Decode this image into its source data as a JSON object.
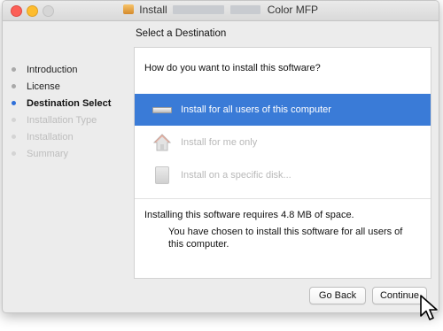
{
  "window": {
    "title_prefix": "Install",
    "title_suffix": "Color MFP"
  },
  "header": {
    "title": "Select a Destination"
  },
  "sidebar": {
    "steps": [
      {
        "label": "Introduction",
        "state": "done"
      },
      {
        "label": "License",
        "state": "done"
      },
      {
        "label": "Destination Select",
        "state": "current"
      },
      {
        "label": "Installation Type",
        "state": "future"
      },
      {
        "label": "Installation",
        "state": "future"
      },
      {
        "label": "Summary",
        "state": "future"
      }
    ]
  },
  "main": {
    "question": "How do you want to install this software?",
    "options": [
      {
        "label": "Install for all users of this computer",
        "icon": "drive-icon",
        "selected": true,
        "enabled": true
      },
      {
        "label": "Install for me only",
        "icon": "home-folder-icon",
        "selected": false,
        "enabled": false
      },
      {
        "label": "Install on a specific disk...",
        "icon": "disk-icon",
        "selected": false,
        "enabled": false
      }
    ],
    "requirement": "Installing this software requires 4.8 MB of space.",
    "chosen": "You have chosen to install this software for all users of this computer."
  },
  "footer": {
    "back_label": "Go Back",
    "continue_label": "Continue"
  },
  "colors": {
    "selection": "#3a7bd7",
    "current_step_dot": "#2e6fd9",
    "close": "#fc5f57",
    "minimize": "#fdbc2e"
  }
}
